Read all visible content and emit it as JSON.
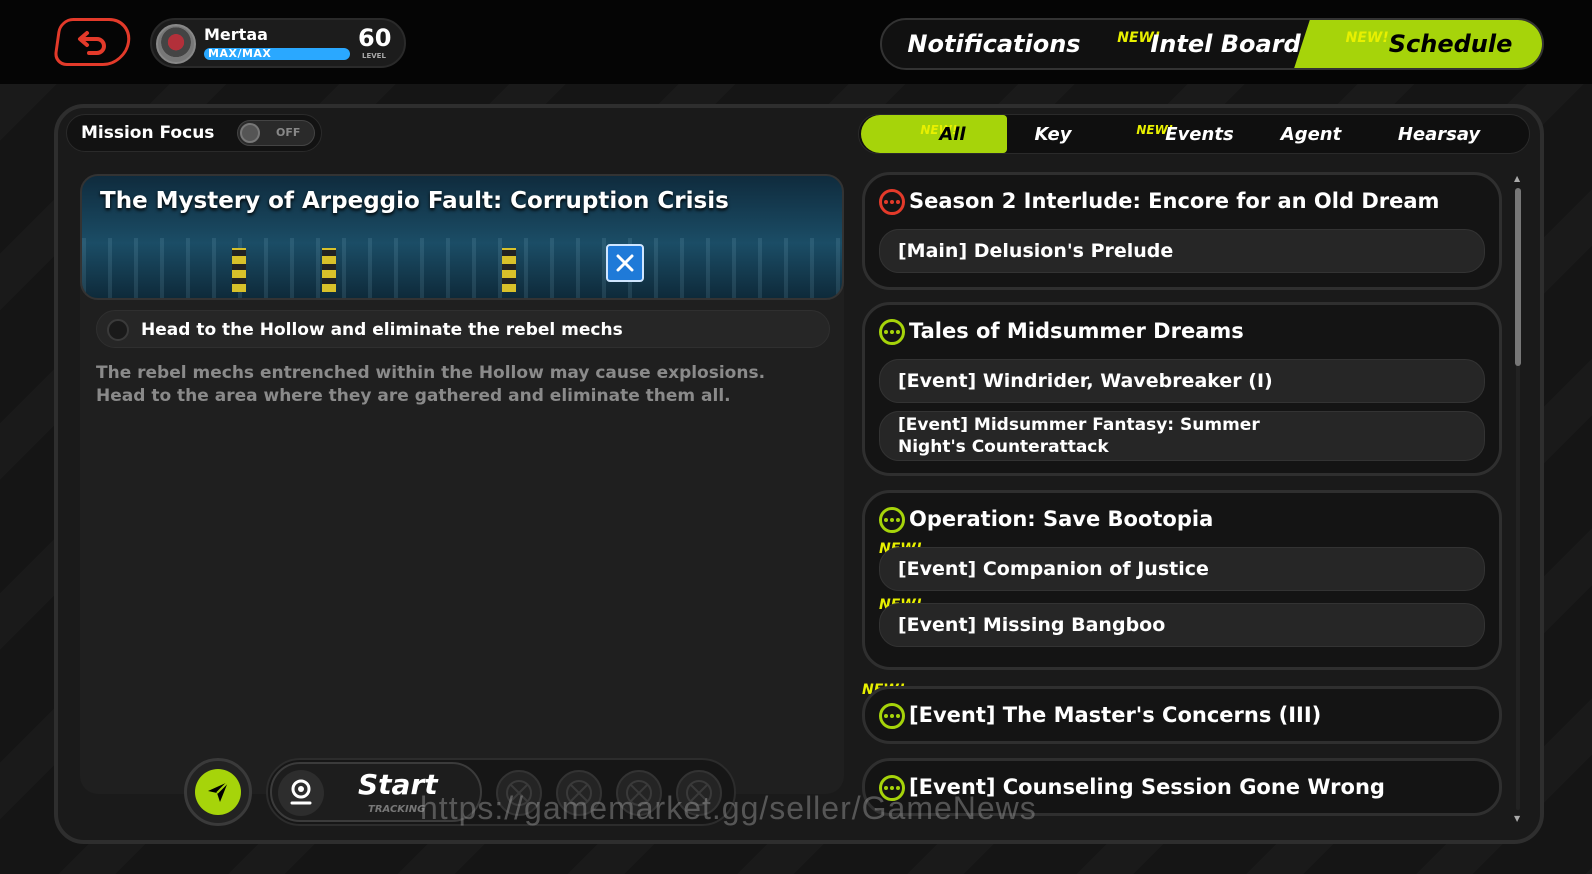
{
  "header": {
    "player_name": "Mertaa",
    "exp_text": "MAX/MAX",
    "exp_fraction": 1.0,
    "level": "60",
    "level_label": "LEVEL",
    "tabs": [
      {
        "label": "Notifications",
        "new": ""
      },
      {
        "label": "Intel Board",
        "new": "NEW!"
      },
      {
        "label": "Schedule",
        "new": "NEW!",
        "active": true
      }
    ]
  },
  "mission_focus": {
    "label": "Mission Focus",
    "toggle_text": "OFF"
  },
  "filter_tabs": [
    {
      "label": "All",
      "new": "NEW!",
      "active": true
    },
    {
      "label": "Key",
      "new": ""
    },
    {
      "label": "Events",
      "new": "NEW!"
    },
    {
      "label": "Agent",
      "new": ""
    },
    {
      "label": "Hearsay",
      "new": ""
    }
  ],
  "detail": {
    "title": "The Mystery of Arpeggio Fault: Corruption Crisis",
    "objective": "Head to the Hollow and eliminate the rebel mechs",
    "description": "The rebel mechs entrenched within the Hollow may cause explosions. Head to the area where they are gathered and eliminate them all."
  },
  "tracking": {
    "start_label": "Start",
    "sub_label": "TRACKING"
  },
  "quest_groups": [
    {
      "title": "Season 2 Interlude: Encore for an Old Dream",
      "icon": "red-dots-icon",
      "quests": [
        {
          "label": "[Main] Delusion's Prelude",
          "new": ""
        }
      ]
    },
    {
      "title": "Tales of Midsummer Dreams",
      "icon": "green-dots-icon",
      "quests": [
        {
          "label": "[Event] Windrider, Wavebreaker (I)",
          "new": ""
        },
        {
          "label": "[Event] Midsummer Fantasy: Summer Night's Counterattack",
          "new": ""
        }
      ]
    },
    {
      "title": "Operation: Save Bootopia",
      "icon": "green-dots-icon",
      "quests": [
        {
          "label": "[Event] Companion of Justice",
          "new": "NEW!"
        },
        {
          "label": "[Event] Missing Bangboo",
          "new": "NEW!"
        }
      ]
    },
    {
      "title": "[Event] The Master's Concerns (III)",
      "icon": "green-dots-icon",
      "new": "NEW!",
      "quests": []
    },
    {
      "title": "[Event] Counseling Session Gone Wrong",
      "icon": "green-dots-icon",
      "quests": []
    }
  ],
  "watermark": "https://gamemarket.gg/seller/GameNews",
  "colors": {
    "accent": "#a6d40a",
    "new_tag": "#e8f000",
    "alert_red": "#e33a2a",
    "exp_blue": "#2aa8ff"
  }
}
